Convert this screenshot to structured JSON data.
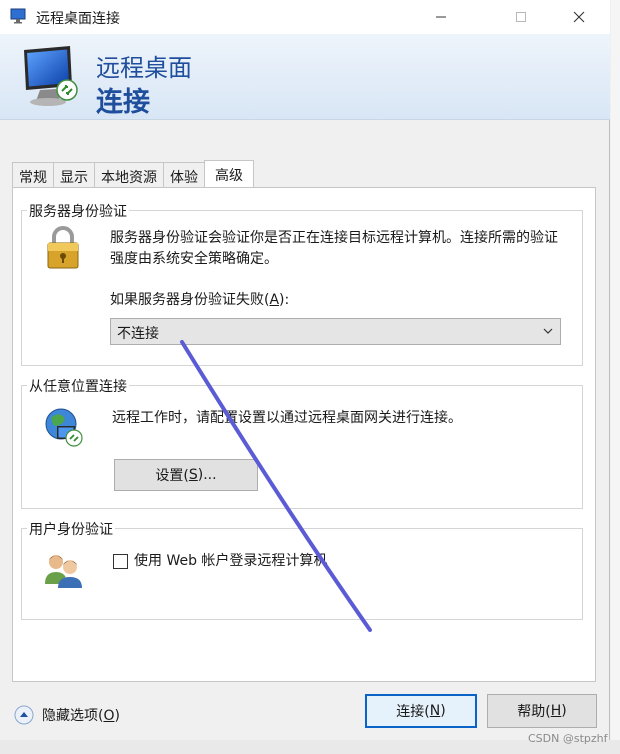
{
  "window": {
    "title": "远程桌面连接",
    "banner_line1": "远程桌面",
    "banner_line2": "连接"
  },
  "tabs": [
    {
      "label": "常规"
    },
    {
      "label": "显示"
    },
    {
      "label": "本地资源"
    },
    {
      "label": "体验"
    },
    {
      "label": "高级",
      "active": true
    }
  ],
  "server_auth": {
    "group_label": "服务器身份验证",
    "description": "服务器身份验证会验证你是否正在连接目标远程计算机。连接所需的验证强度由系统安全策略确定。",
    "fail_label_prefix": "如果服务器身份验证失败(",
    "fail_label_key": "A",
    "fail_label_suffix": "):",
    "selected_option": "不连接"
  },
  "connect_anywhere": {
    "group_label": "从任意位置连接",
    "description": "远程工作时，请配置设置以通过远程桌面网关进行连接。",
    "settings_prefix": "设置(",
    "settings_key": "S",
    "settings_suffix": ")..."
  },
  "user_auth": {
    "group_label": "用户身份验证",
    "checkbox_label": "使用 Web 帐户登录远程计算机",
    "checked": false
  },
  "footer": {
    "hide_options_prefix": "隐藏选项(",
    "hide_options_key": "O",
    "hide_options_suffix": ")",
    "connect_prefix": "连接(",
    "connect_key": "N",
    "connect_suffix": ")",
    "help_prefix": "帮助(",
    "help_key": "H",
    "help_suffix": ")"
  },
  "watermark": "CSDN @stpzhf",
  "colors": {
    "banner_text": "#1f4e9c",
    "stroke": "#5b5bd6",
    "default_button_border": "#0a64c8"
  }
}
